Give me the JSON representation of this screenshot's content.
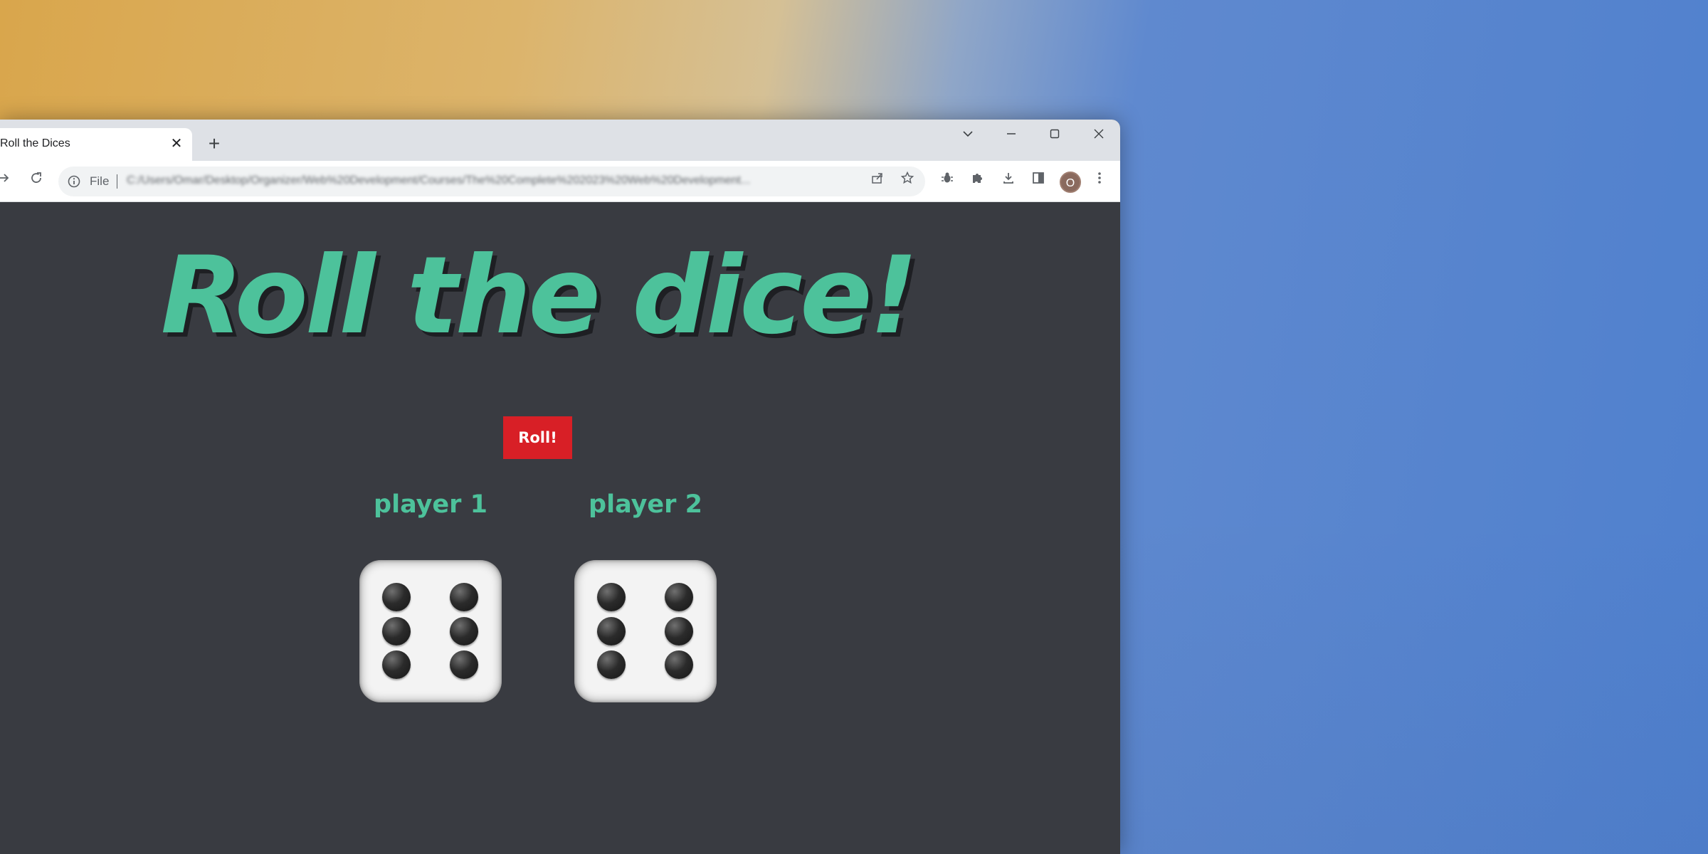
{
  "tab": {
    "title": "Roll the Dices"
  },
  "omnibox": {
    "scheme": "File",
    "url": "C:/Users/Omar/Desktop/Organizer/Web%20Development/Courses/The%20Complete%202023%20Web%20Development..."
  },
  "profile": {
    "initial": "O"
  },
  "page": {
    "heading": "Roll the dice!",
    "roll_button": "Roll!",
    "players": [
      {
        "label": "player 1",
        "die_value": 6
      },
      {
        "label": "player 2",
        "die_value": 6
      }
    ]
  },
  "colors": {
    "heading": "#4dc29b",
    "button": "#d81f26",
    "page_background": "#393b41"
  }
}
